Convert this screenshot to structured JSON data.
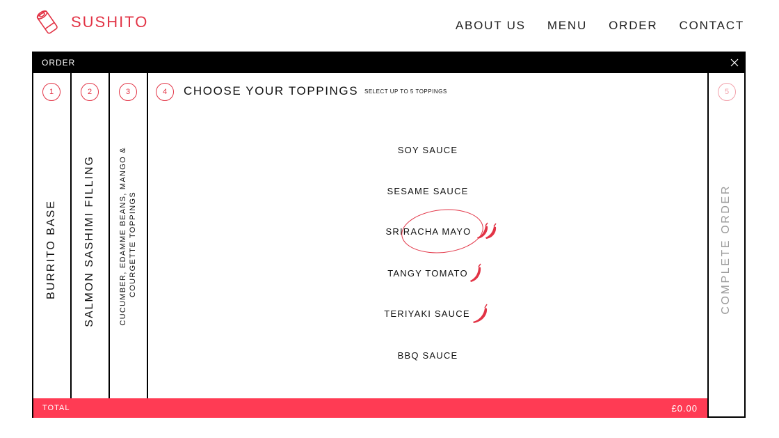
{
  "brand": {
    "name": "SUSHITO",
    "accent_color": "#e23345",
    "logo_icon": "sushi-roll-icon"
  },
  "nav": {
    "items": [
      "ABOUT US",
      "MENU",
      "ORDER",
      "CONTACT"
    ]
  },
  "panel": {
    "title": "ORDER",
    "close_icon": "close-icon",
    "steps": [
      {
        "num": "1",
        "label": "BURRITO BASE"
      },
      {
        "num": "2",
        "label": "SALMON SASHIMI FILLING"
      },
      {
        "num": "3",
        "label_line1": "CUCUMBER, EDAMME BEANS, MANGO &",
        "label_line2": "COURGETTE TOPPINGS"
      },
      {
        "num": "4",
        "heading": "CHOOSE YOUR TOPPINGS",
        "sub": "SELECT UP TO 5 TOPPINGS"
      },
      {
        "num": "5",
        "label": "COMPLETE ORDER"
      }
    ],
    "toppings": [
      {
        "label": "SOY SAUCE",
        "chilies": 0
      },
      {
        "label": "SESAME SAUCE",
        "chilies": 0
      },
      {
        "label": "SRIRACHA MAYO",
        "chilies": 2,
        "selected": true
      },
      {
        "label": "TANGY TOMATO",
        "chilies": 1
      },
      {
        "label": "TERIYAKI SAUCE",
        "chilies": 1
      },
      {
        "label": "BBQ SAUCE",
        "chilies": 0
      }
    ],
    "total": {
      "label": "TOTAL",
      "value": "£0.00",
      "bar_color": "#ff3b54"
    }
  }
}
